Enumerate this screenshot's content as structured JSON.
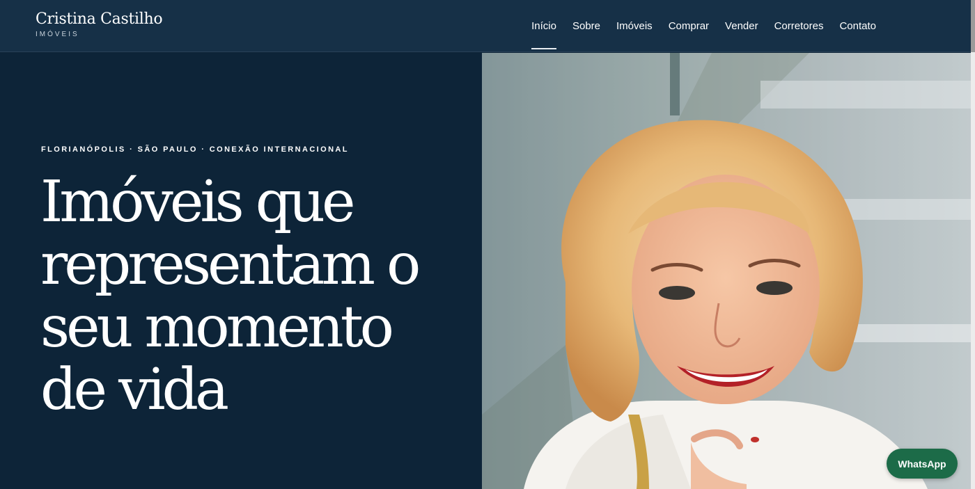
{
  "brand": {
    "name": "Cristina Castilho",
    "subtitle": "IMÓVEIS"
  },
  "nav": {
    "items": [
      {
        "label": "Início",
        "active": true
      },
      {
        "label": "Sobre",
        "active": false
      },
      {
        "label": "Imóveis",
        "active": false
      },
      {
        "label": "Comprar",
        "active": false
      },
      {
        "label": "Vender",
        "active": false
      },
      {
        "label": "Corretores",
        "active": false
      },
      {
        "label": "Contato",
        "active": false
      }
    ]
  },
  "hero": {
    "eyebrow": "FLORIANÓPOLIS · SÃO PAULO · CONEXÃO INTERNACIONAL",
    "headline": "Imóveis que representam o seu momento de vida"
  },
  "whatsapp": {
    "label": "WhatsApp"
  },
  "colors": {
    "header_bg": "#163047",
    "hero_bg": "#0d2438",
    "whatsapp_green": "#1c6b48"
  }
}
